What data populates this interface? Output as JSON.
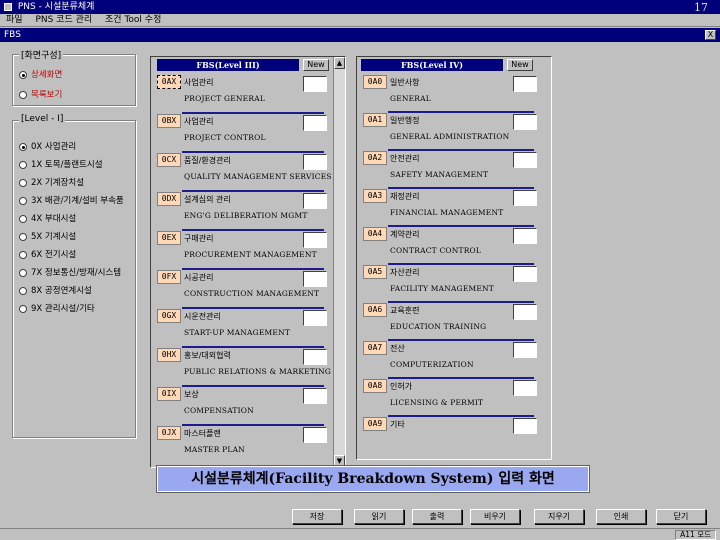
{
  "window": {
    "title": "PNS - 시설분류체계",
    "page_number": "17",
    "menu": [
      "파일",
      "PNS 코드 관리",
      "조건 Tool 수정"
    ],
    "child_title": "FBS",
    "close_label": "X",
    "minimize_label": "_",
    "maximize_label": "□"
  },
  "screen_group": {
    "title": "[화면구성]",
    "options": [
      {
        "label": "상세화면",
        "selected": true
      },
      {
        "label": "목록보기",
        "selected": false
      }
    ]
  },
  "level_group": {
    "title": "[Level - I]",
    "options": [
      {
        "label": "0X 사업관리",
        "selected": true
      },
      {
        "label": "1X 토목/플랜트시설",
        "selected": false
      },
      {
        "label": "2X 기계장치설",
        "selected": false
      },
      {
        "label": "3X 배관/기계/설비 부속품",
        "selected": false
      },
      {
        "label": "4X 부대시설",
        "selected": false
      },
      {
        "label": "5X 기계시설",
        "selected": false
      },
      {
        "label": "6X 전기시설",
        "selected": false
      },
      {
        "label": "7X 정보통신/방재/시스템",
        "selected": false
      },
      {
        "label": "8X 공정연계시설",
        "selected": false
      },
      {
        "label": "9X 관리시설/기타",
        "selected": false
      }
    ]
  },
  "level3": {
    "header": "FBS(Level III)",
    "new_label": "New",
    "rows": [
      {
        "code": "0AX",
        "kor": "사업관리",
        "eng": "PROJECT GENERAL"
      },
      {
        "code": "0BX",
        "kor": "사업관리",
        "eng": "PROJECT CONTROL"
      },
      {
        "code": "0CX",
        "kor": "품질/환경관리",
        "eng": "QUALITY MANAGEMENT SERVICES"
      },
      {
        "code": "0DX",
        "kor": "설계심의 관리",
        "eng": "ENG'G DELIBERATION MGMT"
      },
      {
        "code": "0EX",
        "kor": "구매관리",
        "eng": "PROCUREMENT MANAGEMENT"
      },
      {
        "code": "0FX",
        "kor": "시공관리",
        "eng": "CONSTRUCTION MANAGEMENT"
      },
      {
        "code": "0GX",
        "kor": "시운전관리",
        "eng": "START-UP MANAGEMENT"
      },
      {
        "code": "0HX",
        "kor": "홍보/대외협력",
        "eng": "PUBLIC RELATIONS & MARKETING"
      },
      {
        "code": "0IX",
        "kor": "보상",
        "eng": "COMPENSATION"
      },
      {
        "code": "0JX",
        "kor": "마스터플랜",
        "eng": "MASTER PLAN"
      }
    ]
  },
  "level4": {
    "header": "FBS(Level IV)",
    "new_label": "New",
    "rows": [
      {
        "code": "0A0",
        "kor": "일반사항",
        "eng": "GENERAL"
      },
      {
        "code": "0A1",
        "kor": "일반행정",
        "eng": "GENERAL ADMINISTRATION"
      },
      {
        "code": "0A2",
        "kor": "안전관리",
        "eng": "SAFETY MANAGEMENT"
      },
      {
        "code": "0A3",
        "kor": "재정관리",
        "eng": "FINANCIAL MANAGEMENT"
      },
      {
        "code": "0A4",
        "kor": "계약관리",
        "eng": "CONTRACT CONTROL"
      },
      {
        "code": "0A5",
        "kor": "자산관리",
        "eng": "FACILITY MANAGEMENT"
      },
      {
        "code": "0A6",
        "kor": "교육훈련",
        "eng": "EDUCATION TRAINING"
      },
      {
        "code": "0A7",
        "kor": "전산",
        "eng": "COMPUTERIZATION"
      },
      {
        "code": "0A8",
        "kor": "인허가",
        "eng": "LICENSING & PERMIT"
      },
      {
        "code": "0A9",
        "kor": "기타",
        "eng": ""
      }
    ]
  },
  "caption": "시설분류체계(Facility Breakdown System) 입력 화면",
  "buttons": [
    "저장",
    "읽기",
    "출력",
    "비우기",
    "지우기",
    "인쇄",
    "닫기"
  ],
  "status": "A11 모드"
}
